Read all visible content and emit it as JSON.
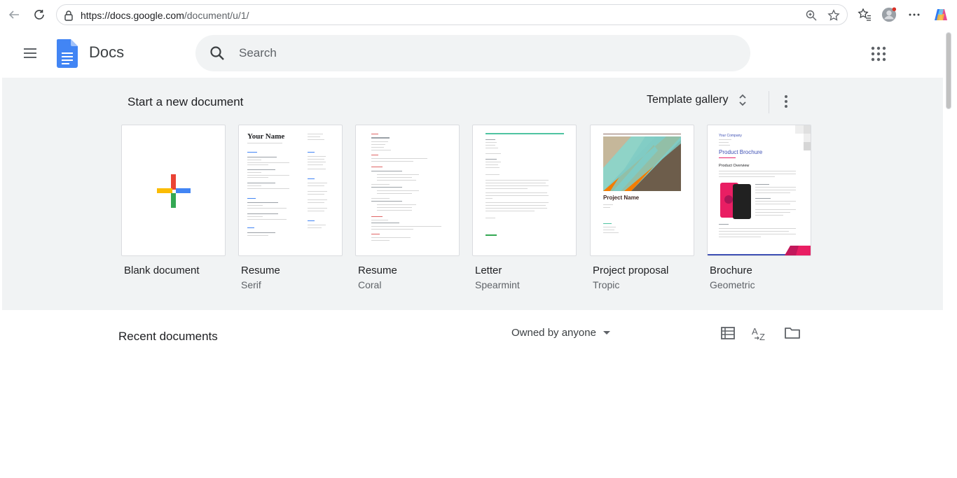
{
  "browser": {
    "url_host": "https://docs.google.com",
    "url_path": "/document/u/1/"
  },
  "header": {
    "app_name": "Docs",
    "search_placeholder": "Search"
  },
  "templates": {
    "heading": "Start a new document",
    "gallery_label": "Template gallery",
    "items": [
      {
        "title": "Blank document",
        "subtitle": ""
      },
      {
        "title": "Resume",
        "subtitle": "Serif",
        "thumb_title": "Your Name"
      },
      {
        "title": "Resume",
        "subtitle": "Coral"
      },
      {
        "title": "Letter",
        "subtitle": "Spearmint"
      },
      {
        "title": "Project proposal",
        "subtitle": "Tropic",
        "thumb_title": "Project Name"
      },
      {
        "title": "Brochure",
        "subtitle": "Geometric",
        "thumb_company": "Your Company",
        "thumb_title": "Product Brochure",
        "thumb_section": "Product Overview"
      }
    ]
  },
  "recent": {
    "heading": "Recent documents",
    "owner_filter": "Owned by anyone"
  },
  "colors": {
    "docs_blue": "#4285f4",
    "google_red": "#ea4335",
    "google_yellow": "#fbbc04",
    "google_green": "#34a853",
    "spearmint": "#4fc3a1",
    "coral": "#e06666",
    "brochure_pink": "#e91e63",
    "brochure_purple": "#3f51b5"
  }
}
